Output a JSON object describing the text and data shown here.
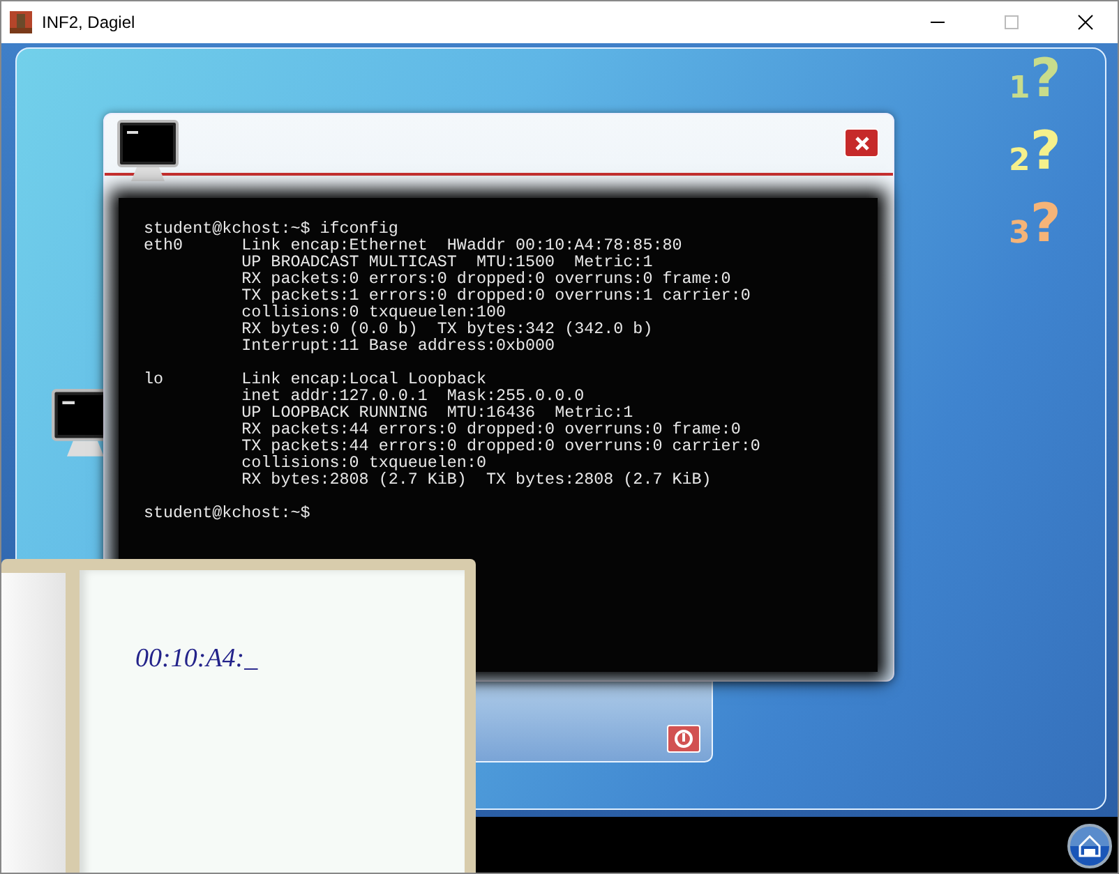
{
  "window": {
    "title": "INF2, Dagiel"
  },
  "terminal": {
    "blocks": [
      [
        "student@kchost:~$ ifconfig",
        "eth0      Link encap:Ethernet  HWaddr 00:10:A4:78:85:80",
        "          UP BROADCAST MULTICAST  MTU:1500  Metric:1",
        "          RX packets:0 errors:0 dropped:0 overruns:0 frame:0",
        "          TX packets:1 errors:0 dropped:0 overruns:1 carrier:0",
        "          collisions:0 txqueuelen:100",
        "          RX bytes:0 (0.0 b)  TX bytes:342 (342.0 b)",
        "          Interrupt:11 Base address:0xb000"
      ],
      [
        "lo        Link encap:Local Loopback",
        "          inet addr:127.0.0.1  Mask:255.0.0.0",
        "          UP LOOPBACK RUNNING  MTU:16436  Metric:1",
        "          RX packets:44 errors:0 dropped:0 overruns:0 frame:0",
        "          TX packets:44 errors:0 dropped:0 overruns:0 carrier:0",
        "          collisions:0 txqueuelen:0",
        "          RX bytes:2808 (2.7 KiB)  TX bytes:2808 (2.7 KiB)"
      ],
      [
        "student@kchost:~$"
      ]
    ]
  },
  "notebook": {
    "text": "00:10:A4:_"
  },
  "questions": [
    {
      "number": "1",
      "mark": "?",
      "color": "#c8dc8c"
    },
    {
      "number": "2",
      "mark": "?",
      "color": "#f5f08c"
    },
    {
      "number": "3",
      "mark": "?",
      "color": "#f5b478"
    }
  ]
}
